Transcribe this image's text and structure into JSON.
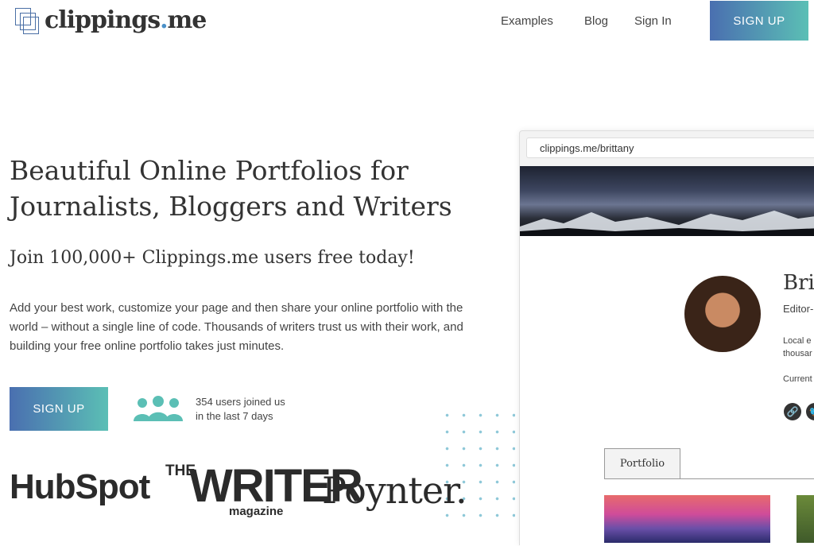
{
  "header": {
    "logo_text": "clippings",
    "logo_dot": ".",
    "logo_suffix": "me",
    "nav": {
      "examples": "Examples",
      "blog": "Blog",
      "sign_in": "Sign In"
    },
    "signup_label": "SIGN UP"
  },
  "hero": {
    "headline_line1": "Beautiful Online Portfolios for",
    "headline_line2": "Journalists, Bloggers and Writers",
    "subhead": "Join 100,000+ Clippings.me users free today!",
    "description": "Add your best work, customize your page and then share your online portfolio with the world – without a single line of code. Thousands of writers trust us with their work, and building your free online portfolio takes just minutes.",
    "signup_label": "SIGN UP",
    "users_line1": "354 users joined us",
    "users_line2": "in the last 7 days"
  },
  "brands": {
    "hubspot": "HubSpot",
    "writer_the": "THE",
    "writer_main": "WRITER",
    "writer_mag": "magazine",
    "poynter": "Poynter."
  },
  "preview": {
    "url": "clippings.me/brittany",
    "name": "Brit",
    "role": "Editor-",
    "bio_line1": "Local e",
    "bio_line2": "thousar",
    "current": "Current",
    "social_link_icon": "🔗",
    "social_bird_icon": "🐦",
    "tab_label": "Portfolio"
  },
  "colors": {
    "accent_start": "#4a6fb0",
    "accent_end": "#5bbfb5",
    "icon_teal": "#5bbfb5"
  }
}
